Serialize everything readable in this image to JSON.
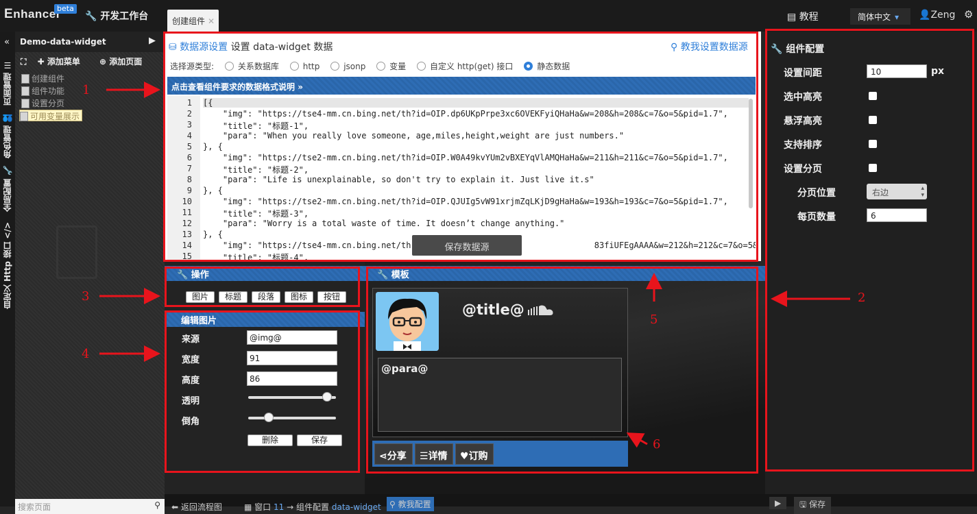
{
  "topbar": {
    "logo_text": "nhancer",
    "beta_badge": "beta",
    "workbench_label": "开发工作台",
    "tab_label": "创建组件",
    "tutorial_label": "教程",
    "language": "简体中文",
    "user_name": "Zeng",
    "accent_color": "#2e6db5"
  },
  "left_nav": {
    "items": [
      "页面管理",
      "角色管理",
      "全局配置",
      "自定义 Http 接口"
    ]
  },
  "tree": {
    "title": "Demo-data-widget",
    "add_menu": "添加菜单",
    "add_page": "添加页面",
    "nodes": [
      "创建组件",
      "组件功能",
      "设置分页",
      "可用变量展示"
    ],
    "search_placeholder": "搜索页面"
  },
  "datasource": {
    "title_link": "数据源设置",
    "title_rest": "设置 data-widget 数据",
    "help_link": "教我设置数据源",
    "type_label": "选择源类型:",
    "types": [
      "关系数据库",
      "http",
      "jsonp",
      "变量",
      "自定义 http(get) 接口",
      "静态数据"
    ],
    "selected_type": "静态数据",
    "format_hint": "点击查看组件要求的数据格式说明",
    "code_lines": [
      "[{",
      "    \"img\": \"https://tse4-mm.cn.bing.net/th?id=OIP.dp6UKpPrpe3xc6OVEKFyiQHaHa&w=208&h=208&c=7&o=5&pid=1.7\",",
      "    \"title\": \"标题-1\",",
      "    \"para\": \"When you really love someone, age,miles,height,weight are just numbers.\"",
      "}, {",
      "    \"img\": \"https://tse2-mm.cn.bing.net/th?id=OIP.W0A49kvYUm2vBXEYqVlAMQHaHa&w=211&h=211&c=7&o=5&pid=1.7\",",
      "    \"title\": \"标题-2\",",
      "    \"para\": \"Life is unexplainable, so don't try to explain it. Just live it.s\"",
      "}, {",
      "    \"img\": \"https://tse2-mm.cn.bing.net/th?id=OIP.QJUIg5vW91xrjmZqLKjD9gHaHa&w=193&h=193&c=7&o=5&pid=1.7\",",
      "    \"title\": \"标题-3\",",
      "    \"para\": \"Worry is a total waste of time. It doesn’t change anything.\"",
      "}, {",
      "    \"img\": \"https://tse4-mm.cn.bing.net/th                                     83fiUFEgAAAA&w=212&h=212&c=7&o=5&pid=1.7\",",
      "    \"title\": \"标题-4\","
    ],
    "save_button": "保存数据源"
  },
  "operation": {
    "title": "操作",
    "buttons": [
      "图片",
      "标题",
      "段落",
      "图标",
      "按钮"
    ]
  },
  "edit_image": {
    "title": "编辑图片",
    "source_label": "来源",
    "source_value": "@img@",
    "width_label": "宽度",
    "width_value": "91",
    "height_label": "高度",
    "height_value": "86",
    "opacity_label": "透明",
    "opacity_fraction": 0.95,
    "radius_label": "倒角",
    "radius_fraction": 0.2,
    "delete_button": "删除",
    "save_button": "保存"
  },
  "template": {
    "title": "模板",
    "title_placeholder": "@title@",
    "para_placeholder": "@para@",
    "buttons": [
      "分享",
      "详情",
      "订购"
    ]
  },
  "config": {
    "title": "组件配置",
    "spacing_label": "设置间距",
    "spacing_value": "10",
    "spacing_unit": "px",
    "select_highlight_label": "选中高亮",
    "hover_highlight_label": "悬浮高亮",
    "sort_label": "支持排序",
    "paging_label": "设置分页",
    "paging_position_label": "分页位置",
    "paging_position_value": "右边",
    "page_size_label": "每页数量",
    "page_size_value": "6"
  },
  "bottom_bar": {
    "back_label": "返回流程图",
    "window_label": "窗口",
    "window_number": "11",
    "crumb_arrow": "→",
    "config_label": "组件配置",
    "widget_name": "data-widget",
    "teach_config": "教我配置",
    "save_label": "保存"
  },
  "annotations": {
    "numbers": [
      "1",
      "2",
      "3",
      "4",
      "5",
      "6"
    ],
    "color": "#e8141c"
  }
}
